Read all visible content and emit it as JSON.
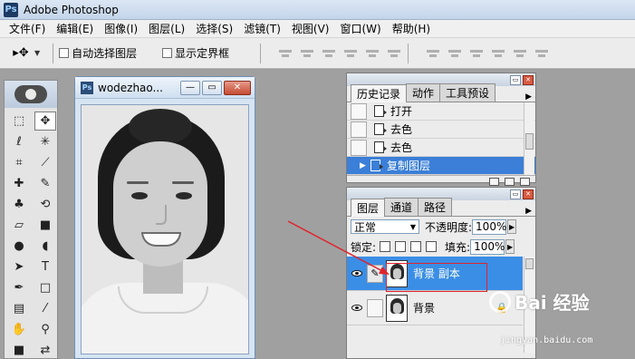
{
  "app": {
    "title": "Adobe Photoshop",
    "logo": "Ps"
  },
  "menu": [
    "文件(F)",
    "编辑(E)",
    "图像(I)",
    "图层(L)",
    "选择(S)",
    "滤镜(T)",
    "视图(V)",
    "窗口(W)",
    "帮助(H)"
  ],
  "options": {
    "tool_icon": "move-tool-icon",
    "auto_select_label": "自动选择图层",
    "show_bounds_label": "显示定界框"
  },
  "document": {
    "title": "wodezhao...",
    "icon": "Ps"
  },
  "history_panel": {
    "tabs": [
      "历史记录",
      "动作",
      "工具预设"
    ],
    "items": [
      "打开",
      "去色",
      "去色",
      "复制图层"
    ],
    "selected_index": 3
  },
  "layers_panel": {
    "tabs": [
      "图层",
      "通道",
      "路径"
    ],
    "blend_mode": "正常",
    "opacity_label": "不透明度:",
    "opacity_value": "100%",
    "lock_label": "锁定:",
    "fill_label": "填充:",
    "fill_value": "100%",
    "layers": [
      {
        "name": "背景 副本",
        "selected": true
      },
      {
        "name": "背景",
        "selected": false
      }
    ]
  },
  "watermark": {
    "text": "Bai 经验",
    "sub": "jingyan.baidu.com"
  },
  "colors": {
    "selection": "#3b8ee6",
    "history_selection": "#3b7fd8",
    "annotation": "#e0242e"
  }
}
